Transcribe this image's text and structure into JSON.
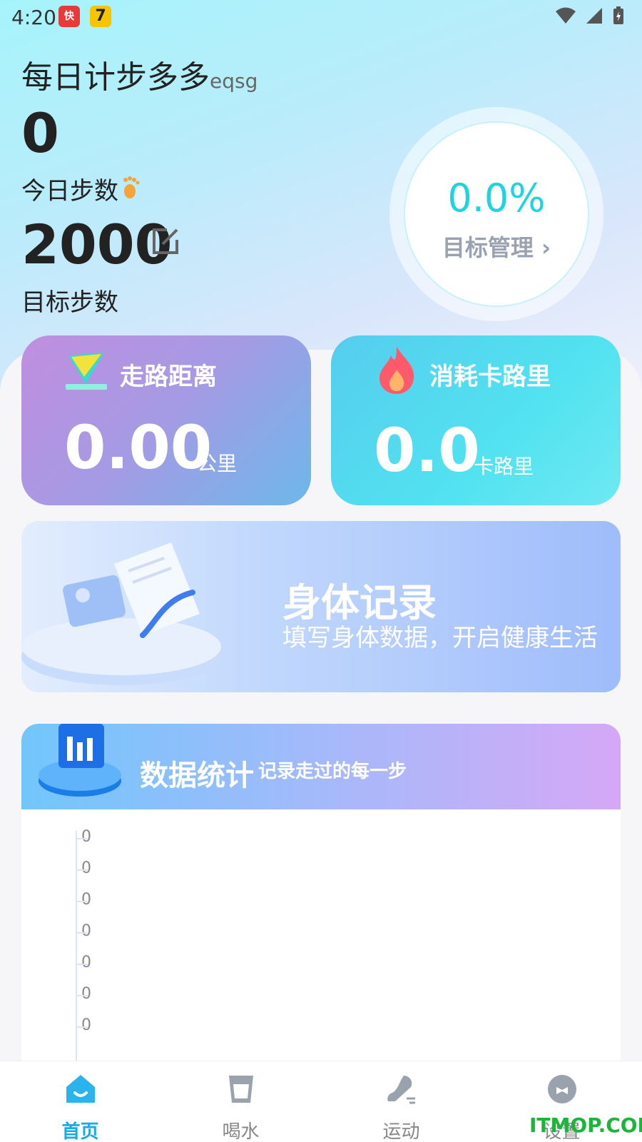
{
  "status": {
    "time": "4:20",
    "notif1": "快",
    "notif2": "7"
  },
  "header": {
    "app_name": "每日计步多多",
    "app_suffix": "eqsg"
  },
  "today": {
    "steps": "0",
    "label": "今日步数"
  },
  "goal": {
    "steps": "2000",
    "label": "目标步数"
  },
  "progress": {
    "percent_text": "0.0%",
    "link_label": "目标管理 ›",
    "fraction": 0.0
  },
  "cards": {
    "walk": {
      "title": "走路距离",
      "value": "0.00",
      "unit": "公里"
    },
    "calories": {
      "title": "消耗卡路里",
      "value": "0.0",
      "unit": "卡路里"
    }
  },
  "body_record": {
    "title": "身体记录",
    "subtitle": "填写身体数据，开启健康生活"
  },
  "stats": {
    "title": "数据统计",
    "subtitle": "记录走过的每一步",
    "y_ticks": [
      "0",
      "0",
      "0",
      "0",
      "0",
      "0",
      "0"
    ]
  },
  "tabs": [
    {
      "label": "首页",
      "icon": "home-icon",
      "active": true
    },
    {
      "label": "喝水",
      "icon": "cup-icon",
      "active": false
    },
    {
      "label": "运动",
      "icon": "shoe-icon",
      "active": false
    },
    {
      "label": "设置",
      "icon": "settings-icon",
      "active": false
    }
  ],
  "watermark": "ITMOP.COM",
  "colors": {
    "accent": "#1aa8e8",
    "ring_text": "#1ed3e3"
  }
}
